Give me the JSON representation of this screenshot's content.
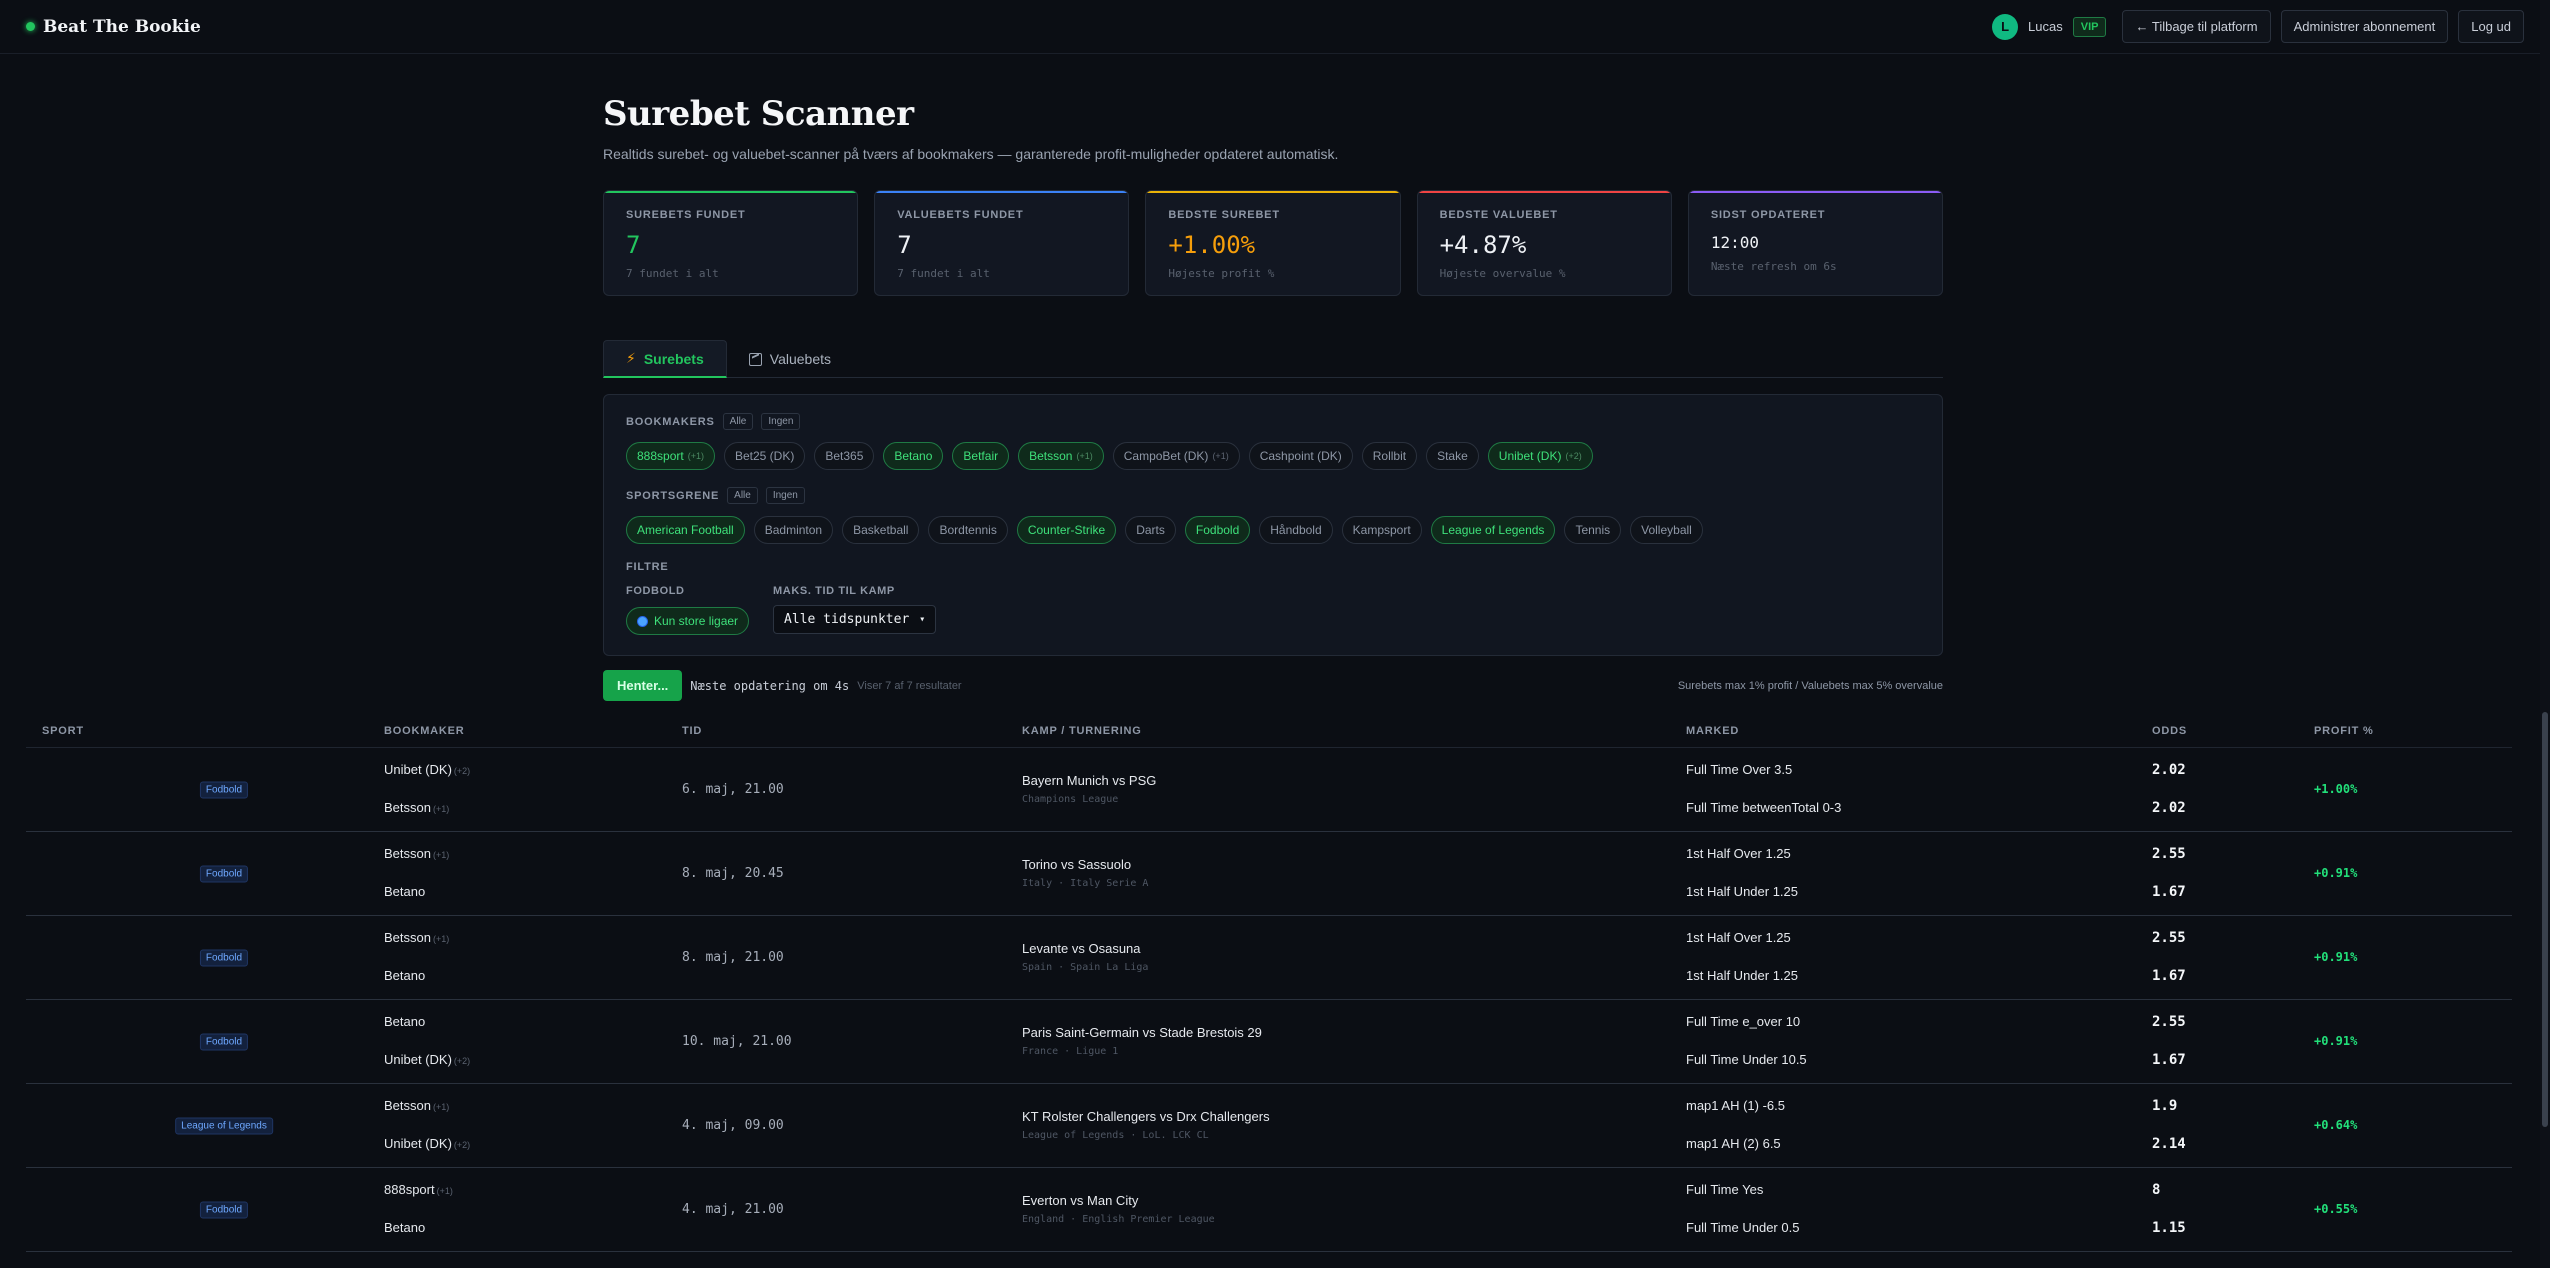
{
  "brand": "Beat The Bookie",
  "user": {
    "initial": "L",
    "name": "Lucas",
    "badge": "VIP"
  },
  "nav": {
    "back": "← Tilbage til platform",
    "manage": "Administrer abonnement",
    "logout": "Log ud"
  },
  "page": {
    "title": "Surebet Scanner",
    "subtitle": "Realtids surebet- og valuebet-scanner på tværs af bookmakers — garanterede profit-muligheder opdateret automatisk."
  },
  "stats": [
    {
      "label": "SUREBETS FUNDET",
      "value": "7",
      "sub": "7 fundet i alt",
      "accent": "#22c55e",
      "color": "#22c55e"
    },
    {
      "label": "VALUEBETS FUNDET",
      "value": "7",
      "sub": "7 fundet i alt",
      "accent": "#3b82f6",
      "color": "#eef1f5"
    },
    {
      "label": "BEDSTE SUREBET",
      "value": "+1.00%",
      "sub": "Højeste profit %",
      "accent": "#eab308",
      "color": "#f59e0b"
    },
    {
      "label": "BEDSTE VALUEBET",
      "value": "+4.87%",
      "sub": "Højeste overvalue %",
      "accent": "#ef4444",
      "color": "#eef1f5"
    },
    {
      "label": "SIDST OPDATERET",
      "value": "12:00",
      "sub": "Næste refresh om 6s",
      "accent": "#8b5cf6",
      "color": "#eef1f5"
    }
  ],
  "tabs": {
    "surebets": "Surebets",
    "valuebets": "Valuebets"
  },
  "filters": {
    "all_label": "Alle",
    "none_label": "Ingen",
    "bookmakers_label": "BOOKMAKERS",
    "bookmakers": [
      {
        "name": "888sport",
        "count": "(+1)",
        "on": true
      },
      {
        "name": "Bet25 (DK)",
        "count": "",
        "on": false
      },
      {
        "name": "Bet365",
        "count": "",
        "on": false
      },
      {
        "name": "Betano",
        "count": "",
        "on": true
      },
      {
        "name": "Betfair",
        "count": "",
        "on": true
      },
      {
        "name": "Betsson",
        "count": "(+1)",
        "on": true
      },
      {
        "name": "CampoBet (DK)",
        "count": "(+1)",
        "on": false
      },
      {
        "name": "Cashpoint (DK)",
        "count": "",
        "on": false
      },
      {
        "name": "Rollbit",
        "count": "",
        "on": false
      },
      {
        "name": "Stake",
        "count": "",
        "on": false
      },
      {
        "name": "Unibet (DK)",
        "count": "(+2)",
        "on": true
      }
    ],
    "sports_label": "SPORTSGRENE",
    "sports": [
      {
        "name": "American Football",
        "on": true
      },
      {
        "name": "Badminton",
        "on": false
      },
      {
        "name": "Basketball",
        "on": false
      },
      {
        "name": "Bordtennis",
        "on": false
      },
      {
        "name": "Counter-Strike",
        "on": true
      },
      {
        "name": "Darts",
        "on": false
      },
      {
        "name": "Fodbold",
        "on": true
      },
      {
        "name": "Håndbold",
        "on": false
      },
      {
        "name": "Kampsport",
        "on": false
      },
      {
        "name": "League of Legends",
        "on": true
      },
      {
        "name": "Tennis",
        "on": false
      },
      {
        "name": "Volleyball",
        "on": false
      }
    ],
    "filter_label": "FILTRE",
    "football_label": "FODBOLD",
    "big_leagues": "Kun store ligaer",
    "max_time_label": "MAKS. TID TIL KAMP",
    "max_time_value": "Alle tidspunkter"
  },
  "status": {
    "fetch": "Henter...",
    "next_update": "Næste opdatering om 4s",
    "showing": "Viser 7 af 7 resultater",
    "limits": "Surebets max 1% profit / Valuebets max 5% overvalue"
  },
  "table": {
    "headers": {
      "sport": "SPORT",
      "bookmaker": "BOOKMAKER",
      "time": "TID",
      "match": "KAMP / TURNERING",
      "market": "MARKED",
      "odds": "ODDS",
      "profit": "PROFIT %"
    },
    "rows": [
      {
        "sport": "Fodbold",
        "bm1": "Unibet (DK)",
        "bm1c": "(+2)",
        "bm2": "Betsson",
        "bm2c": "(+1)",
        "time": "6. maj, 21.00",
        "match": "Bayern Munich vs PSG",
        "league": "Champions League",
        "m1": "Full Time Over 3.5",
        "m2": "Full Time betweenTotal 0-3",
        "o1": "2.02",
        "o2": "2.02",
        "profit": "+1.00%"
      },
      {
        "sport": "Fodbold",
        "bm1": "Betsson",
        "bm1c": "(+1)",
        "bm2": "Betano",
        "bm2c": "",
        "time": "8. maj, 20.45",
        "match": "Torino vs Sassuolo",
        "league": "Italy · Italy Serie A",
        "m1": "1st Half Over 1.25",
        "m2": "1st Half Under 1.25",
        "o1": "2.55",
        "o2": "1.67",
        "profit": "+0.91%"
      },
      {
        "sport": "Fodbold",
        "bm1": "Betsson",
        "bm1c": "(+1)",
        "bm2": "Betano",
        "bm2c": "",
        "time": "8. maj, 21.00",
        "match": "Levante vs Osasuna",
        "league": "Spain · Spain La Liga",
        "m1": "1st Half Over 1.25",
        "m2": "1st Half Under 1.25",
        "o1": "2.55",
        "o2": "1.67",
        "profit": "+0.91%"
      },
      {
        "sport": "Fodbold",
        "bm1": "Betano",
        "bm1c": "",
        "bm2": "Unibet (DK)",
        "bm2c": "(+2)",
        "time": "10. maj, 21.00",
        "match": "Paris Saint-Germain vs Stade Brestois 29",
        "league": "France · Ligue 1",
        "m1": "Full Time e_over 10",
        "m2": "Full Time Under 10.5",
        "o1": "2.55",
        "o2": "1.67",
        "profit": "+0.91%"
      },
      {
        "sport": "League of Legends",
        "bm1": "Betsson",
        "bm1c": "(+1)",
        "bm2": "Unibet (DK)",
        "bm2c": "(+2)",
        "time": "4. maj, 09.00",
        "match": "KT Rolster Challengers vs Drx Challengers",
        "league": "League of Legends · LoL. LCK CL",
        "m1": "map1 AH (1) -6.5",
        "m2": "map1 AH (2) 6.5",
        "o1": "1.9",
        "o2": "2.14",
        "profit": "+0.64%"
      },
      {
        "sport": "Fodbold",
        "bm1": "888sport",
        "bm1c": "(+1)",
        "bm2": "Betano",
        "bm2c": "",
        "time": "4. maj, 21.00",
        "match": "Everton vs Man City",
        "league": "England · English Premier League",
        "m1": "Full Time Yes",
        "m2": "Full Time Under 0.5",
        "o1": "8",
        "o2": "1.15",
        "profit": "+0.55%"
      }
    ]
  }
}
